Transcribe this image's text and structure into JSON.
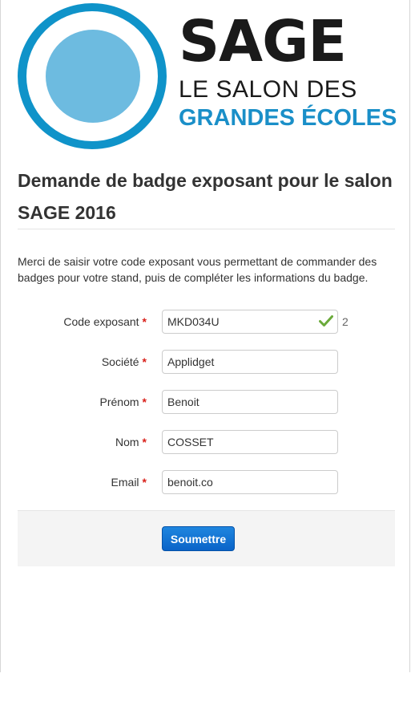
{
  "logo": {
    "name": "SAGE",
    "line2": "LE SALON DES",
    "line3": "GRANDES ÉCOLES",
    "colors": {
      "ring": "#0f93c9",
      "disc": "#6dbbe0",
      "accent_text": "#1a8fc8"
    }
  },
  "title": "Demande de badge exposant pour le salon SAGE 2016",
  "intro": "Merci de saisir votre code exposant vous permettant de commander des badges pour votre stand, puis de compléter les informations du badge.",
  "form": {
    "required_marker": "*",
    "fields": [
      {
        "label": "Code exposant",
        "value": "MKD034U",
        "valid": true,
        "counter": "2"
      },
      {
        "label": "Société",
        "value": "Applidget"
      },
      {
        "label": "Prénom",
        "value": "Benoit"
      },
      {
        "label": "Nom",
        "value": "COSSET"
      },
      {
        "label": "Email",
        "value": "benoit.co"
      }
    ],
    "submit_label": "Soumettre"
  },
  "colors": {
    "required": "#d9201a",
    "button": "#0a63c8",
    "valid_check": "#6aaa3a"
  }
}
